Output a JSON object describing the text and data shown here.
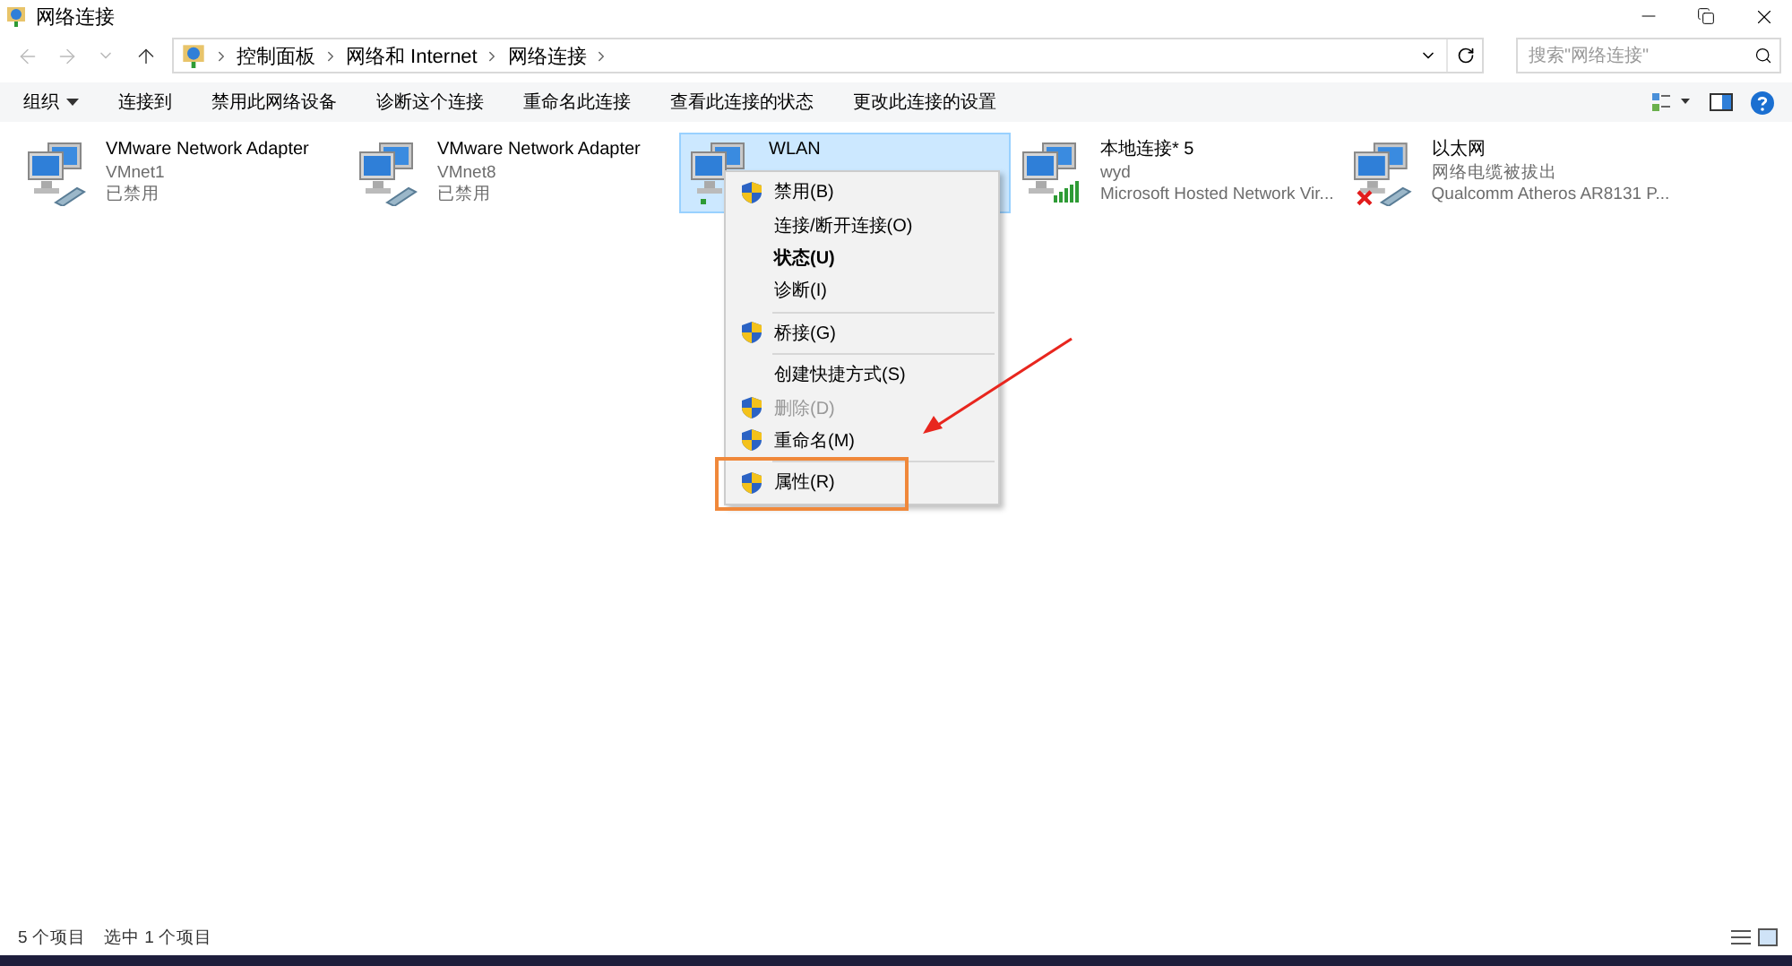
{
  "window": {
    "title": "网络连接"
  },
  "address": {
    "crumbs": [
      "控制面板",
      "网络和 Internet",
      "网络连接"
    ],
    "search_placeholder": "搜索\"网络连接\""
  },
  "toolbar": {
    "organize": "组织",
    "commands": [
      "连接到",
      "禁用此网络设备",
      "诊断这个连接",
      "重命名此连接",
      "查看此连接的状态",
      "更改此连接的设置"
    ]
  },
  "adapters": [
    {
      "name": "VMware Network Adapter",
      "line_2": "VMnet1",
      "line_3": "已禁用",
      "kind": "cable",
      "selected": false
    },
    {
      "name": "VMware Network Adapter",
      "line_2": "VMnet8",
      "line_3": "已禁用",
      "kind": "cable",
      "selected": false
    },
    {
      "name": "WLAN",
      "kind": "wireless",
      "selected": true
    },
    {
      "name": "本地连接* 5",
      "line_2": "wyd",
      "line_3": "Microsoft Hosted Network Vir...",
      "kind": "signal",
      "selected": false
    },
    {
      "name": "以太网",
      "line_2": "网络电缆被拔出",
      "line_3": "Qualcomm Atheros AR8131 P...",
      "kind": "unplugged",
      "selected": false
    }
  ],
  "context_menu": [
    {
      "kind": "item",
      "label": "禁用(B)",
      "shield": true,
      "bold": false,
      "disabled": false,
      "annotated": false
    },
    {
      "kind": "item",
      "label": "连接/断开连接(O)",
      "shield": false,
      "bold": false,
      "disabled": false,
      "annotated": false
    },
    {
      "kind": "item",
      "label": "状态(U)",
      "shield": false,
      "bold": true,
      "disabled": false,
      "annotated": false
    },
    {
      "kind": "item",
      "label": "诊断(I)",
      "shield": false,
      "bold": false,
      "disabled": false,
      "annotated": false
    },
    {
      "kind": "separator"
    },
    {
      "kind": "item",
      "label": "桥接(G)",
      "shield": true,
      "bold": false,
      "disabled": false,
      "annotated": false
    },
    {
      "kind": "separator"
    },
    {
      "kind": "item",
      "label": "创建快捷方式(S)",
      "shield": false,
      "bold": false,
      "disabled": false,
      "annotated": false
    },
    {
      "kind": "item",
      "label": "删除(D)",
      "shield": true,
      "bold": false,
      "disabled": true,
      "annotated": false
    },
    {
      "kind": "item",
      "label": "重命名(M)",
      "shield": true,
      "bold": false,
      "disabled": false,
      "annotated": false
    },
    {
      "kind": "separator"
    },
    {
      "kind": "item",
      "label": "属性(R)",
      "shield": true,
      "bold": false,
      "disabled": false,
      "annotated": true
    }
  ],
  "status_bar": {
    "count": "5 个项目",
    "selection": "选中 1 个项目"
  }
}
